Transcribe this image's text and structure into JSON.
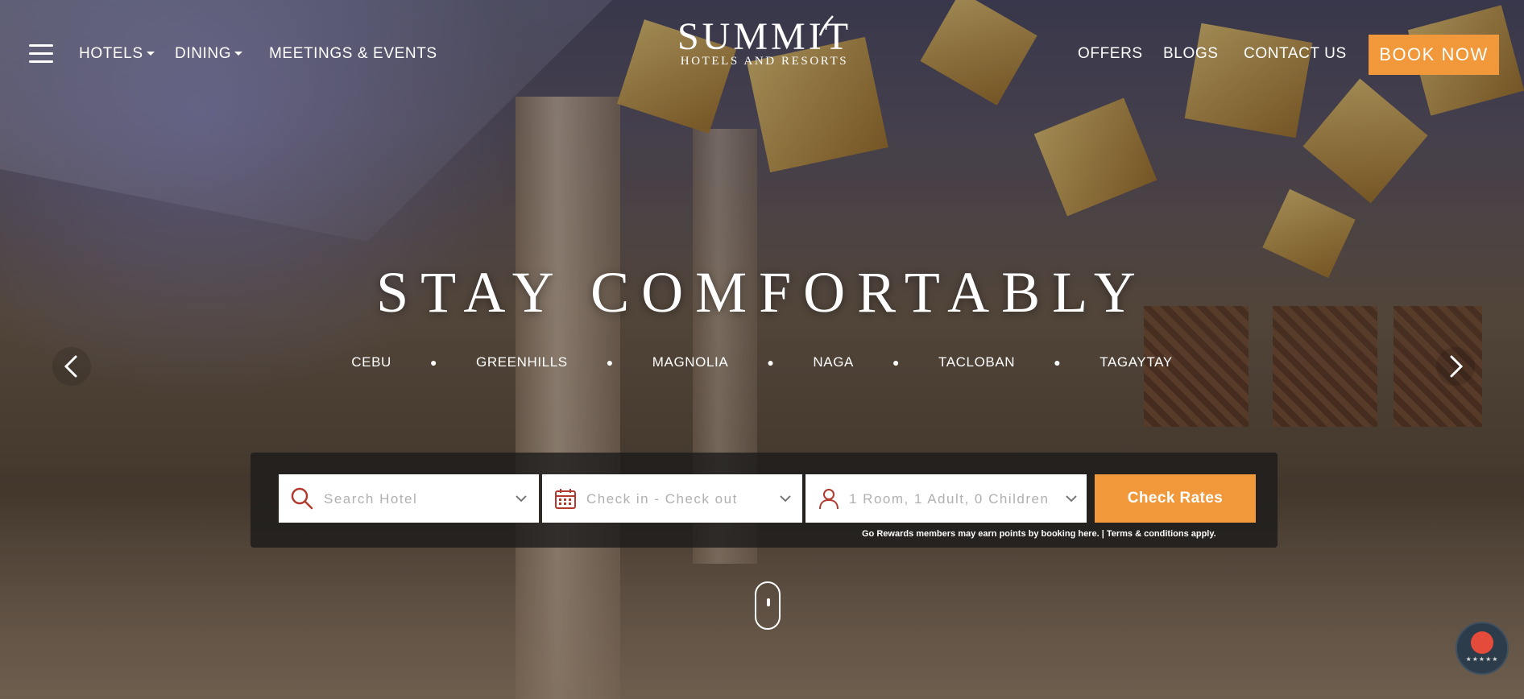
{
  "nav": {
    "menu_icon": "hamburger-icon",
    "items_left": [
      "HOTELS",
      "DINING",
      "MEETINGS & EVENTS"
    ],
    "items_right": [
      "OFFERS",
      "BLOGS",
      "CONTACT US"
    ],
    "book_now": "BOOK NOW"
  },
  "logo": {
    "main": "SUMMIT",
    "sub": "HOTELS AND RESORTS"
  },
  "hero": {
    "headline": "STAY COMFORTABLY",
    "cities": [
      "CEBU",
      "GREENHILLS",
      "MAGNOLIA",
      "NAGA",
      "TACLOBAN",
      "TAGAYTAY"
    ],
    "prev_icon": "chevron-left-icon",
    "next_icon": "chevron-right-icon"
  },
  "booking": {
    "search_placeholder": "Search Hotel",
    "dates_placeholder": "Check in - Check out",
    "guests_value": "1 Room, 1 Adult, 0 Children",
    "check_rates": "Check Rates",
    "rewards_note": "Go Rewards members may earn points by booking here. | Terms & conditions apply."
  },
  "badge": {
    "stars": "★★★★★"
  },
  "colors": {
    "accent": "#f0983a",
    "icon_red": "#b03a2e",
    "bar_bg": "#191919"
  }
}
